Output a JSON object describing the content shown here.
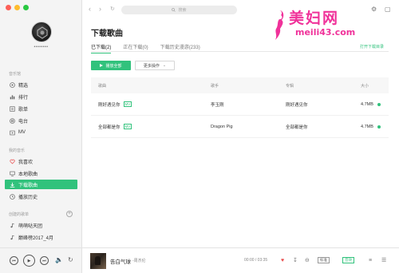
{
  "sidebar": {
    "username": "••••••••",
    "sections": {
      "music_hall": "音乐馆",
      "my_music": "我的音乐",
      "created_playlists": "创建的歌单"
    },
    "music_hall_items": [
      {
        "label": "精选",
        "icon": "star-circle-icon"
      },
      {
        "label": "排行",
        "icon": "chart-bars-icon"
      },
      {
        "label": "歌单",
        "icon": "playlist-icon"
      },
      {
        "label": "电台",
        "icon": "radio-icon"
      },
      {
        "label": "MV",
        "icon": "video-icon"
      }
    ],
    "my_music_items": [
      {
        "label": "我喜欢",
        "icon": "heart-icon"
      },
      {
        "label": "本地歌曲",
        "icon": "monitor-icon"
      },
      {
        "label": "下载歌曲",
        "icon": "download-icon",
        "active": true
      },
      {
        "label": "播放历史",
        "icon": "clock-icon"
      }
    ],
    "playlists": [
      {
        "label": "萌萌哒天团"
      },
      {
        "label": "巅峰榜2017_4月"
      }
    ]
  },
  "search": {
    "placeholder": "搜索"
  },
  "main": {
    "title": "下载歌曲",
    "tabs": [
      {
        "label": "已下载(2)",
        "active": true
      },
      {
        "label": "正在下载(0)"
      },
      {
        "label": "下载历史漫游(233)"
      }
    ],
    "open_folder": "打开下载目录",
    "play_all": "播放全部",
    "more_actions": "更多操作",
    "columns": {
      "song": "歌曲",
      "artist": "歌手",
      "album": "专辑",
      "size": "大小"
    },
    "rows": [
      {
        "song": "刚好遇见你",
        "mv": "MV",
        "artist": "李玉刚",
        "album": "刚好遇见你",
        "size": "4.7MB"
      },
      {
        "song": "全部都是你",
        "mv": "MV",
        "artist": "Dragon Pig",
        "album": "全部都是你",
        "size": "4.7MB"
      }
    ]
  },
  "player": {
    "title": "告白气球",
    "artist": "-周杰伦",
    "time": "00:00 / 03:35",
    "quality": "标准",
    "effect": "音效"
  },
  "watermark": {
    "chinese": "美妇网",
    "url": "meili43.com"
  },
  "colors": {
    "accent": "#31c27c",
    "watermark": "#f0329a"
  }
}
